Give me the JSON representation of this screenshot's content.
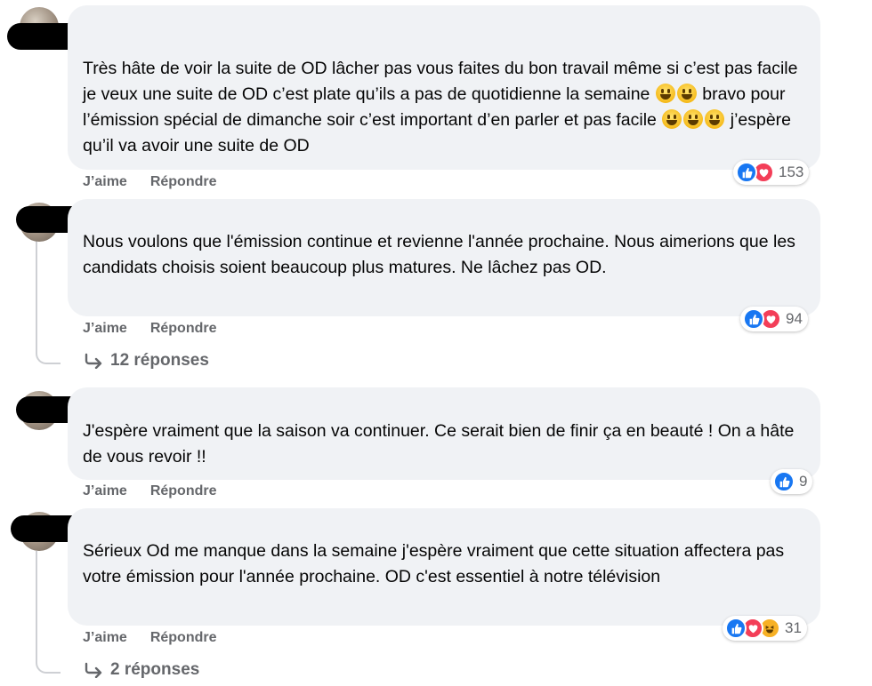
{
  "comments": [
    {
      "text_parts": [
        "Très hâte de voir la suite de OD lâcher pas vous faites du bon travail même si c’est pas facile je veux une suite de OD c’est plate qu’ils a pas de quotidienne la semaine ",
        " bravo pour l’émission spécial de dimanche soir c’est important d’en parler et pas facile ",
        " j’espère qu’il va avoir une suite de OD"
      ],
      "like_label": "J’aime",
      "reply_label": "Répondre",
      "reaction_count": "153",
      "reactions": [
        "like-icon",
        "love-icon"
      ]
    },
    {
      "text": "Nous voulons que l'émission continue et revienne l'année prochaine. Nous aimerions que les candidats choisis soient beaucoup plus matures. Ne lâchez pas OD.",
      "like_label": "J’aime",
      "reply_label": "Répondre",
      "reaction_count": "94",
      "reactions": [
        "like-icon",
        "love-icon"
      ],
      "replies_label": "12 réponses"
    },
    {
      "text": "J'espère vraiment que la saison va continuer. Ce serait bien de finir ça en beauté ! On a hâte de vous revoir !!",
      "like_label": "J’aime",
      "reply_label": "Répondre",
      "reaction_count": "9",
      "reactions": [
        "like-icon"
      ]
    },
    {
      "text": "Sérieux Od me manque dans la semaine j'espère vraiment que cette situation affectera pas votre émission pour l'année prochaine. OD c'est essentiel à notre télévision",
      "like_label": "J’aime",
      "reply_label": "Répondre",
      "reaction_count": "31",
      "reactions": [
        "like-icon",
        "love-icon",
        "haha-icon"
      ],
      "replies_label": "2 réponses"
    }
  ],
  "colors": {
    "bubble": "#f0f2f5",
    "secondary_text": "#65676b",
    "like_blue": "#1877f2",
    "love_red": "#f33e58",
    "haha_yellow": "#f7b125"
  }
}
